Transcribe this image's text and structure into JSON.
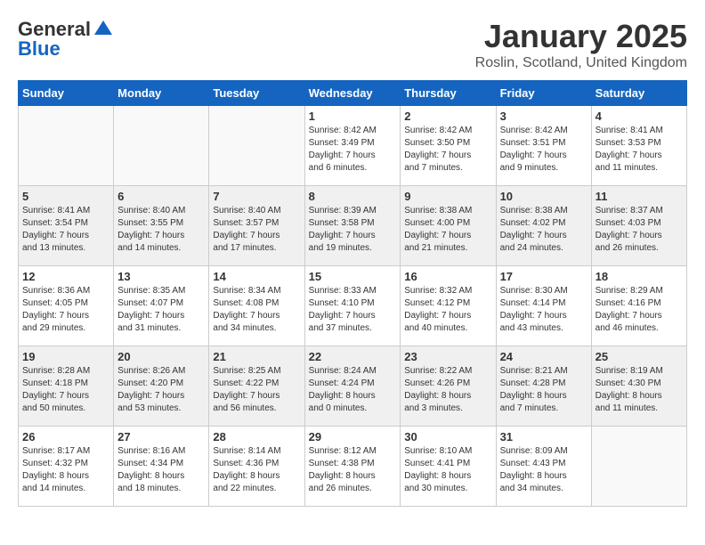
{
  "header": {
    "logo_general": "General",
    "logo_blue": "Blue",
    "month_title": "January 2025",
    "location": "Roslin, Scotland, United Kingdom"
  },
  "weekdays": [
    "Sunday",
    "Monday",
    "Tuesday",
    "Wednesday",
    "Thursday",
    "Friday",
    "Saturday"
  ],
  "weeks": [
    [
      {
        "day": "",
        "info": ""
      },
      {
        "day": "",
        "info": ""
      },
      {
        "day": "",
        "info": ""
      },
      {
        "day": "1",
        "info": "Sunrise: 8:42 AM\nSunset: 3:49 PM\nDaylight: 7 hours\nand 6 minutes."
      },
      {
        "day": "2",
        "info": "Sunrise: 8:42 AM\nSunset: 3:50 PM\nDaylight: 7 hours\nand 7 minutes."
      },
      {
        "day": "3",
        "info": "Sunrise: 8:42 AM\nSunset: 3:51 PM\nDaylight: 7 hours\nand 9 minutes."
      },
      {
        "day": "4",
        "info": "Sunrise: 8:41 AM\nSunset: 3:53 PM\nDaylight: 7 hours\nand 11 minutes."
      }
    ],
    [
      {
        "day": "5",
        "info": "Sunrise: 8:41 AM\nSunset: 3:54 PM\nDaylight: 7 hours\nand 13 minutes."
      },
      {
        "day": "6",
        "info": "Sunrise: 8:40 AM\nSunset: 3:55 PM\nDaylight: 7 hours\nand 14 minutes."
      },
      {
        "day": "7",
        "info": "Sunrise: 8:40 AM\nSunset: 3:57 PM\nDaylight: 7 hours\nand 17 minutes."
      },
      {
        "day": "8",
        "info": "Sunrise: 8:39 AM\nSunset: 3:58 PM\nDaylight: 7 hours\nand 19 minutes."
      },
      {
        "day": "9",
        "info": "Sunrise: 8:38 AM\nSunset: 4:00 PM\nDaylight: 7 hours\nand 21 minutes."
      },
      {
        "day": "10",
        "info": "Sunrise: 8:38 AM\nSunset: 4:02 PM\nDaylight: 7 hours\nand 24 minutes."
      },
      {
        "day": "11",
        "info": "Sunrise: 8:37 AM\nSunset: 4:03 PM\nDaylight: 7 hours\nand 26 minutes."
      }
    ],
    [
      {
        "day": "12",
        "info": "Sunrise: 8:36 AM\nSunset: 4:05 PM\nDaylight: 7 hours\nand 29 minutes."
      },
      {
        "day": "13",
        "info": "Sunrise: 8:35 AM\nSunset: 4:07 PM\nDaylight: 7 hours\nand 31 minutes."
      },
      {
        "day": "14",
        "info": "Sunrise: 8:34 AM\nSunset: 4:08 PM\nDaylight: 7 hours\nand 34 minutes."
      },
      {
        "day": "15",
        "info": "Sunrise: 8:33 AM\nSunset: 4:10 PM\nDaylight: 7 hours\nand 37 minutes."
      },
      {
        "day": "16",
        "info": "Sunrise: 8:32 AM\nSunset: 4:12 PM\nDaylight: 7 hours\nand 40 minutes."
      },
      {
        "day": "17",
        "info": "Sunrise: 8:30 AM\nSunset: 4:14 PM\nDaylight: 7 hours\nand 43 minutes."
      },
      {
        "day": "18",
        "info": "Sunrise: 8:29 AM\nSunset: 4:16 PM\nDaylight: 7 hours\nand 46 minutes."
      }
    ],
    [
      {
        "day": "19",
        "info": "Sunrise: 8:28 AM\nSunset: 4:18 PM\nDaylight: 7 hours\nand 50 minutes."
      },
      {
        "day": "20",
        "info": "Sunrise: 8:26 AM\nSunset: 4:20 PM\nDaylight: 7 hours\nand 53 minutes."
      },
      {
        "day": "21",
        "info": "Sunrise: 8:25 AM\nSunset: 4:22 PM\nDaylight: 7 hours\nand 56 minutes."
      },
      {
        "day": "22",
        "info": "Sunrise: 8:24 AM\nSunset: 4:24 PM\nDaylight: 8 hours\nand 0 minutes."
      },
      {
        "day": "23",
        "info": "Sunrise: 8:22 AM\nSunset: 4:26 PM\nDaylight: 8 hours\nand 3 minutes."
      },
      {
        "day": "24",
        "info": "Sunrise: 8:21 AM\nSunset: 4:28 PM\nDaylight: 8 hours\nand 7 minutes."
      },
      {
        "day": "25",
        "info": "Sunrise: 8:19 AM\nSunset: 4:30 PM\nDaylight: 8 hours\nand 11 minutes."
      }
    ],
    [
      {
        "day": "26",
        "info": "Sunrise: 8:17 AM\nSunset: 4:32 PM\nDaylight: 8 hours\nand 14 minutes."
      },
      {
        "day": "27",
        "info": "Sunrise: 8:16 AM\nSunset: 4:34 PM\nDaylight: 8 hours\nand 18 minutes."
      },
      {
        "day": "28",
        "info": "Sunrise: 8:14 AM\nSunset: 4:36 PM\nDaylight: 8 hours\nand 22 minutes."
      },
      {
        "day": "29",
        "info": "Sunrise: 8:12 AM\nSunset: 4:38 PM\nDaylight: 8 hours\nand 26 minutes."
      },
      {
        "day": "30",
        "info": "Sunrise: 8:10 AM\nSunset: 4:41 PM\nDaylight: 8 hours\nand 30 minutes."
      },
      {
        "day": "31",
        "info": "Sunrise: 8:09 AM\nSunset: 4:43 PM\nDaylight: 8 hours\nand 34 minutes."
      },
      {
        "day": "",
        "info": ""
      }
    ]
  ]
}
